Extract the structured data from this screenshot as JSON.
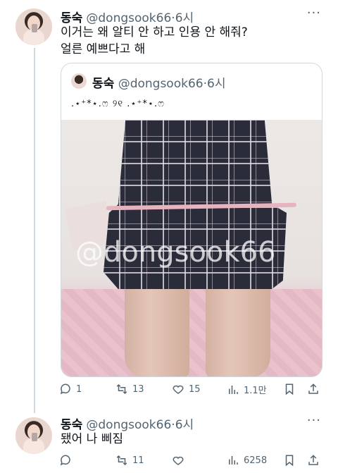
{
  "tweet1": {
    "name": "동숙",
    "handle": "@dongsook66",
    "time": "6시",
    "more": "···",
    "text_line1": "이거는 왜 알티 안 하고 인용 안 해줘?",
    "text_line2": "얼른 예쁘다고 해",
    "quote": {
      "name": "동숙",
      "handle": "@dongsook66",
      "time": "6시",
      "text": ".⋆⁺*⋆.ෆ ୨୧ .⋆⁺*⋆.ෆ",
      "watermark": "@dongsook66"
    },
    "actions": {
      "reply": "1",
      "retweet": "13",
      "like": "15",
      "views": "1.1만"
    }
  },
  "tweet2": {
    "name": "동숙",
    "handle": "@dongsook66",
    "time": "6시",
    "text": "됐어 나 삐짐",
    "actions": {
      "reply": "",
      "retweet": "11",
      "like": "",
      "views": "6258"
    }
  }
}
